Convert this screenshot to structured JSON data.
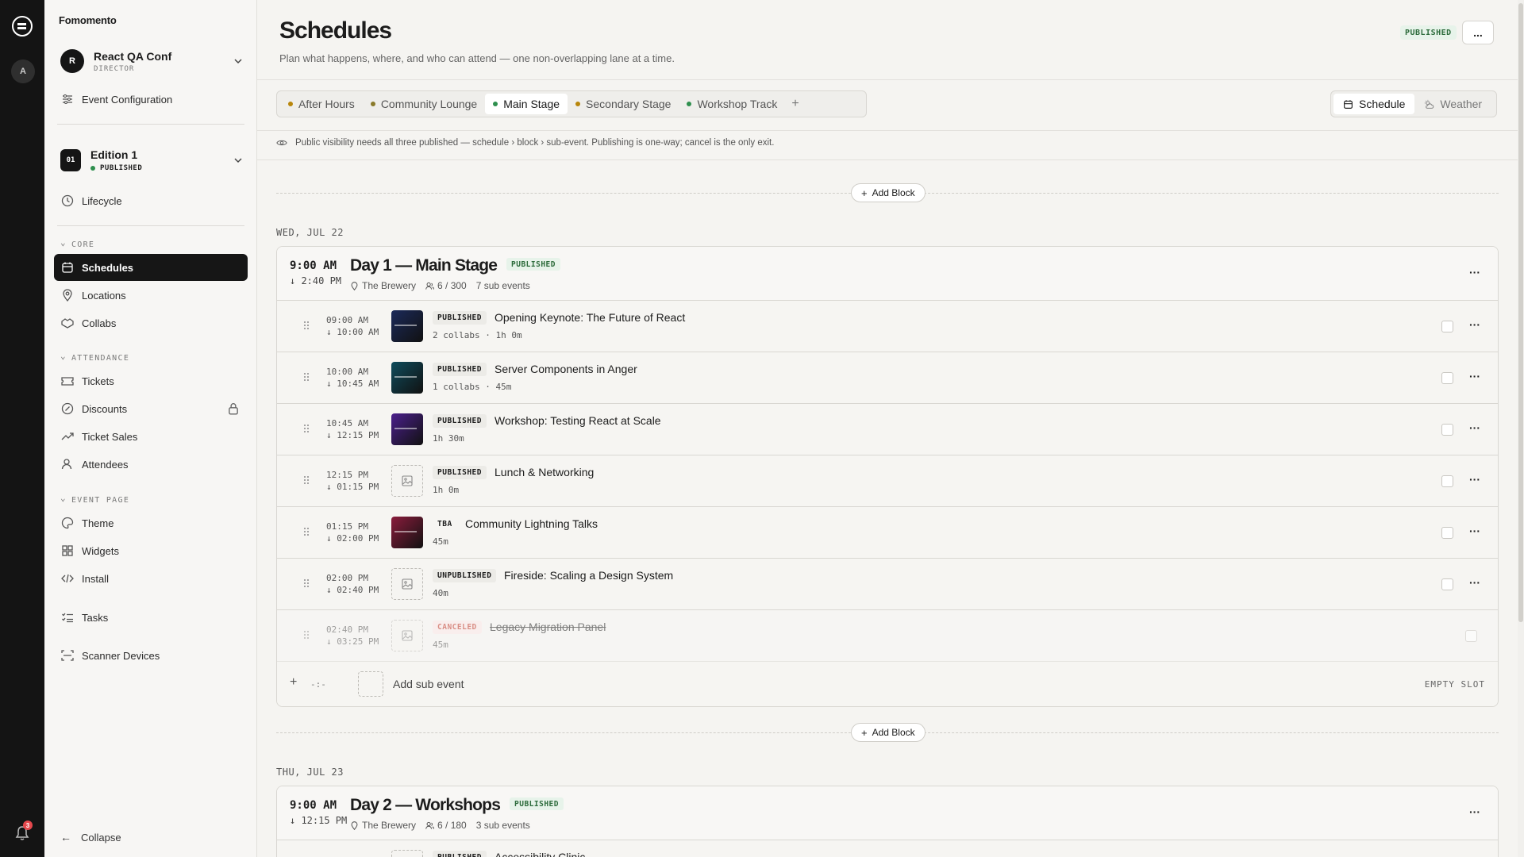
{
  "rail": {
    "avatar": "A",
    "notifications": "3"
  },
  "sidebar": {
    "brand": "Fomomento",
    "org": {
      "avatar": "R",
      "name": "React QA Conf",
      "role": "DIRECTOR"
    },
    "event_config": "Event Configuration",
    "edition": {
      "badge": "01",
      "name": "Edition 1",
      "status": "PUBLISHED"
    },
    "lifecycle": "Lifecycle",
    "sections": {
      "core": "CORE",
      "attendance": "ATTENDANCE",
      "event_page": "EVENT PAGE"
    },
    "items": {
      "schedules": "Schedules",
      "locations": "Locations",
      "collabs": "Collabs",
      "tickets": "Tickets",
      "discounts": "Discounts",
      "ticket_sales": "Ticket Sales",
      "attendees": "Attendees",
      "theme": "Theme",
      "widgets": "Widgets",
      "install": "Install",
      "tasks": "Tasks",
      "scanner_devices": "Scanner Devices"
    },
    "collapse": "Collapse"
  },
  "header": {
    "title": "Schedules",
    "subtitle": "Plan what happens, where, and who can attend — one non-overlapping lane at a time.",
    "status": "PUBLISHED",
    "more": "..."
  },
  "tabs": [
    {
      "label": "After Hours",
      "color": "#b8860b"
    },
    {
      "label": "Community Lounge",
      "color": "#8a7a2b"
    },
    {
      "label": "Main Stage",
      "color": "#2f8f4e"
    },
    {
      "label": "Secondary Stage",
      "color": "#b8860b"
    },
    {
      "label": "Workshop Track",
      "color": "#2f8f4e"
    }
  ],
  "view_toggle": {
    "schedule": "Schedule",
    "weather": "Weather"
  },
  "notice": "Public visibility needs all three published — schedule › block › sub-event. Publishing is one-way; cancel is the only exit.",
  "add_block_label": "Add Block",
  "days": [
    {
      "label": "WED, JUL 22",
      "block": {
        "start": "9:00 AM",
        "end": "2:40 PM",
        "title": "Day 1 — Main Stage",
        "status": "PUBLISHED",
        "location": "The Brewery",
        "capacity": "6 / 300",
        "sub_count": "7 sub events",
        "events": [
          {
            "start": "09:00 AM",
            "end": "10:00 AM",
            "badge": "PUBLISHED",
            "title": "Opening Keynote: The Future of React",
            "meta": "2 collabs · 1h 0m",
            "thumb": "#1b2a5a"
          },
          {
            "start": "10:00 AM",
            "end": "10:45 AM",
            "badge": "PUBLISHED",
            "title": "Server Components in Anger",
            "meta": "1 collabs · 45m",
            "thumb": "#0f4c5c"
          },
          {
            "start": "10:45 AM",
            "end": "12:15 PM",
            "badge": "PUBLISHED",
            "title": "Workshop: Testing React at Scale",
            "meta": "1h 30m",
            "thumb": "#4b1f8c"
          },
          {
            "start": "12:15 PM",
            "end": "01:15 PM",
            "badge": "PUBLISHED",
            "title": "Lunch & Networking",
            "meta": "1h 0m",
            "thumb": ""
          },
          {
            "start": "01:15 PM",
            "end": "02:00 PM",
            "badge": "TBA",
            "title": "Community Lightning Talks",
            "meta": "45m",
            "thumb": "#8a1c3c"
          },
          {
            "start": "02:00 PM",
            "end": "02:40 PM",
            "badge": "UNPUBLISHED",
            "title": "Fireside: Scaling a Design System",
            "meta": "40m",
            "thumb": ""
          },
          {
            "start": "02:40 PM",
            "end": "03:25 PM",
            "badge": "CANCELED",
            "title": "Legacy Migration Panel",
            "meta": "45m",
            "thumb": ""
          }
        ],
        "add_sub": {
          "blank": "-:-",
          "label": "Add sub event",
          "slot": "EMPTY SLOT"
        }
      }
    },
    {
      "label": "THU, JUL 23",
      "block": {
        "start": "9:00 AM",
        "end": "12:15 PM",
        "title": "Day 2 — Workshops",
        "status": "PUBLISHED",
        "location": "The Brewery",
        "capacity": "6 / 180",
        "sub_count": "3 sub events",
        "events": [
          {
            "start": "",
            "end": "",
            "badge": "PUBLISHED",
            "title": "Accessibility Clinic",
            "meta": "",
            "thumb": ""
          }
        ]
      }
    }
  ]
}
